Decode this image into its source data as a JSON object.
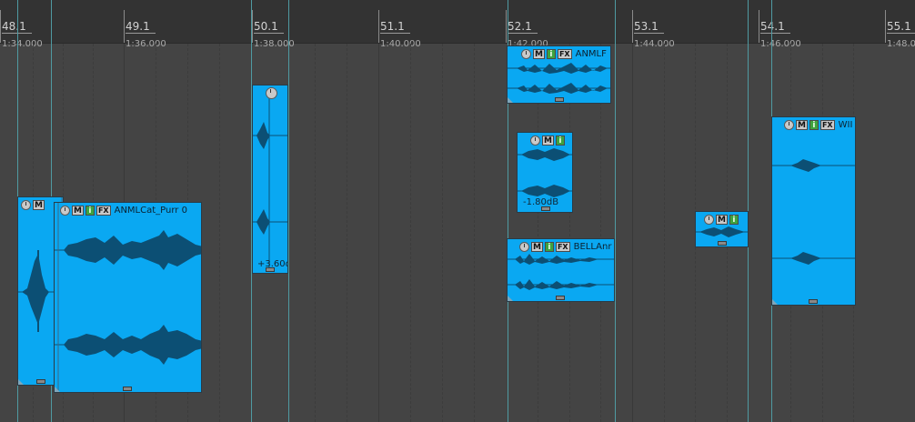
{
  "timeline": {
    "markers": [
      {
        "bar": "48.1",
        "time": "1:34.000"
      },
      {
        "bar": "49.1",
        "time": "1:36.000"
      },
      {
        "bar": "50.1",
        "time": "1:38.000"
      },
      {
        "bar": "51.1",
        "time": "1:40.000"
      },
      {
        "bar": "52.1",
        "time": "1:42.000"
      },
      {
        "bar": "53.1",
        "time": "1:44.000"
      },
      {
        "bar": "54.1",
        "time": "1:46.000"
      },
      {
        "bar": "55.1",
        "time": "1:48.0"
      }
    ]
  },
  "items": [
    {
      "id": "item-a",
      "buttons": [
        "M"
      ],
      "take": "",
      "volume": ""
    },
    {
      "id": "item-b",
      "buttons": [
        "M",
        "i",
        "FX"
      ],
      "take": "ANMLCat_Purr 0",
      "volume": ""
    },
    {
      "id": "item-c",
      "buttons": [],
      "take": "",
      "volume": "+3.60d"
    },
    {
      "id": "item-d",
      "buttons": [
        "M",
        "i",
        "FX"
      ],
      "take": "ANMLF",
      "volume": ""
    },
    {
      "id": "item-e",
      "buttons": [
        "M",
        "i"
      ],
      "take": "",
      "volume": "-1.80dB"
    },
    {
      "id": "item-f",
      "buttons": [
        "M",
        "i",
        "FX"
      ],
      "take": "BELLAnr",
      "volume": ""
    },
    {
      "id": "item-g",
      "buttons": [
        "M",
        "i"
      ],
      "take": "",
      "volume": ""
    },
    {
      "id": "item-h",
      "buttons": [
        "M",
        "i",
        "FX"
      ],
      "take": "WII",
      "volume": ""
    }
  ],
  "colors": {
    "item": "#0aa8f2",
    "waveform": "#0c4f74",
    "mute_button": "#c9c9c9",
    "info_button": "#3fa33f"
  },
  "icons": [
    "volume-knob-icon",
    "mute-button",
    "info-button",
    "fx-button",
    "item-handle-icon"
  ]
}
